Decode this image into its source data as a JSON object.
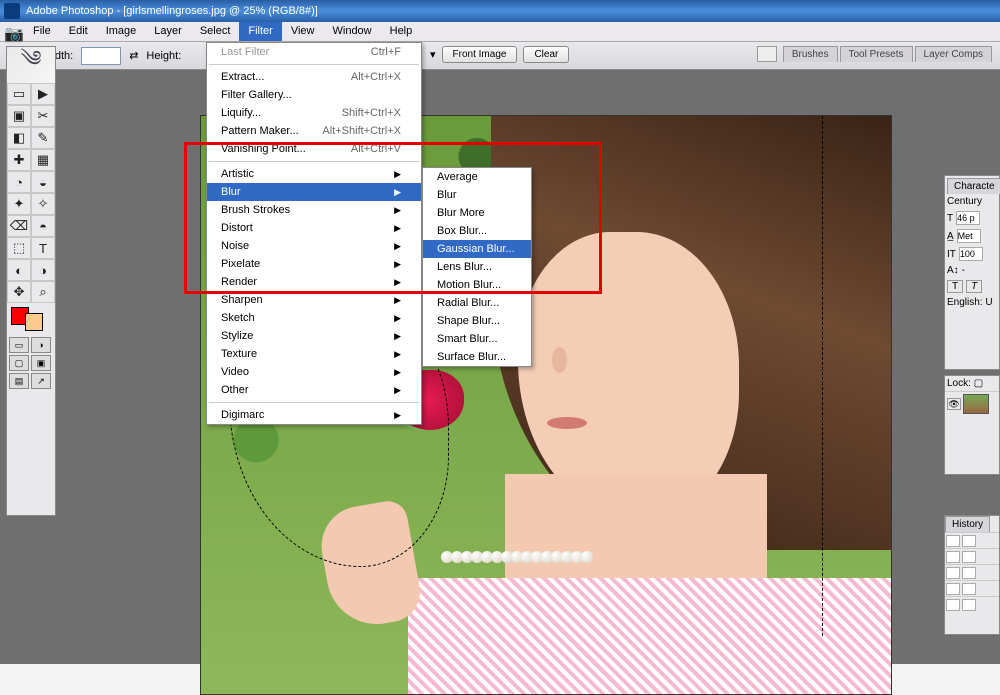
{
  "title": "Adobe Photoshop - [girlsmellingroses.jpg @ 25% (RGB/8#)]",
  "menubar": [
    "File",
    "Edit",
    "Image",
    "Layer",
    "Select",
    "Filter",
    "View",
    "Window",
    "Help"
  ],
  "menubar_open_index": 5,
  "options": {
    "width_label": "Width:",
    "height_label": "Height:",
    "front_image": "Front Image",
    "clear": "Clear"
  },
  "palette_tabs": [
    "Brushes",
    "Tool Presets",
    "Layer Comps"
  ],
  "filter_menu": {
    "top": [
      {
        "label": "Last Filter",
        "shortcut": "Ctrl+F",
        "disabled": true
      },
      {
        "sep": true
      },
      {
        "label": "Extract...",
        "shortcut": "Alt+Ctrl+X"
      },
      {
        "label": "Filter Gallery..."
      },
      {
        "label": "Liquify...",
        "shortcut": "Shift+Ctrl+X"
      },
      {
        "label": "Pattern Maker...",
        "shortcut": "Alt+Shift+Ctrl+X"
      },
      {
        "label": "Vanishing Point...",
        "shortcut": "Alt+Ctrl+V"
      },
      {
        "sep": true
      }
    ],
    "groups": [
      "Artistic",
      "Blur",
      "Brush Strokes",
      "Distort",
      "Noise",
      "Pixelate",
      "Render",
      "Sharpen",
      "Sketch",
      "Stylize",
      "Texture",
      "Video",
      "Other"
    ],
    "groups_hl_index": 1,
    "bottom": [
      {
        "sep": true
      },
      {
        "label": "Digimarc",
        "sub": true
      }
    ]
  },
  "blur_submenu": [
    "Average",
    "Blur",
    "Blur More",
    "Box Blur...",
    "Gaussian Blur...",
    "Lens Blur...",
    "Motion Blur...",
    "Radial Blur...",
    "Shape Blur...",
    "Smart Blur...",
    "Surface Blur..."
  ],
  "blur_submenu_hl_index": 4,
  "tools": [
    "▭",
    "▶",
    "▣",
    "✂",
    "◧",
    "✎",
    "✚",
    "▦",
    "◔",
    "◒",
    "✦",
    "✧",
    "⌫",
    "◓",
    "⬚",
    "T",
    "◐",
    "◑",
    "✥",
    "⌕"
  ],
  "char_panel": {
    "tab": "Characte",
    "font": "Century",
    "size": "46 p",
    "tracking": "100",
    "leading": "Met",
    "lang": "English: U",
    "T": "T"
  },
  "layers": {
    "lock_label": "Lock:"
  },
  "history": {
    "tab": "History"
  }
}
